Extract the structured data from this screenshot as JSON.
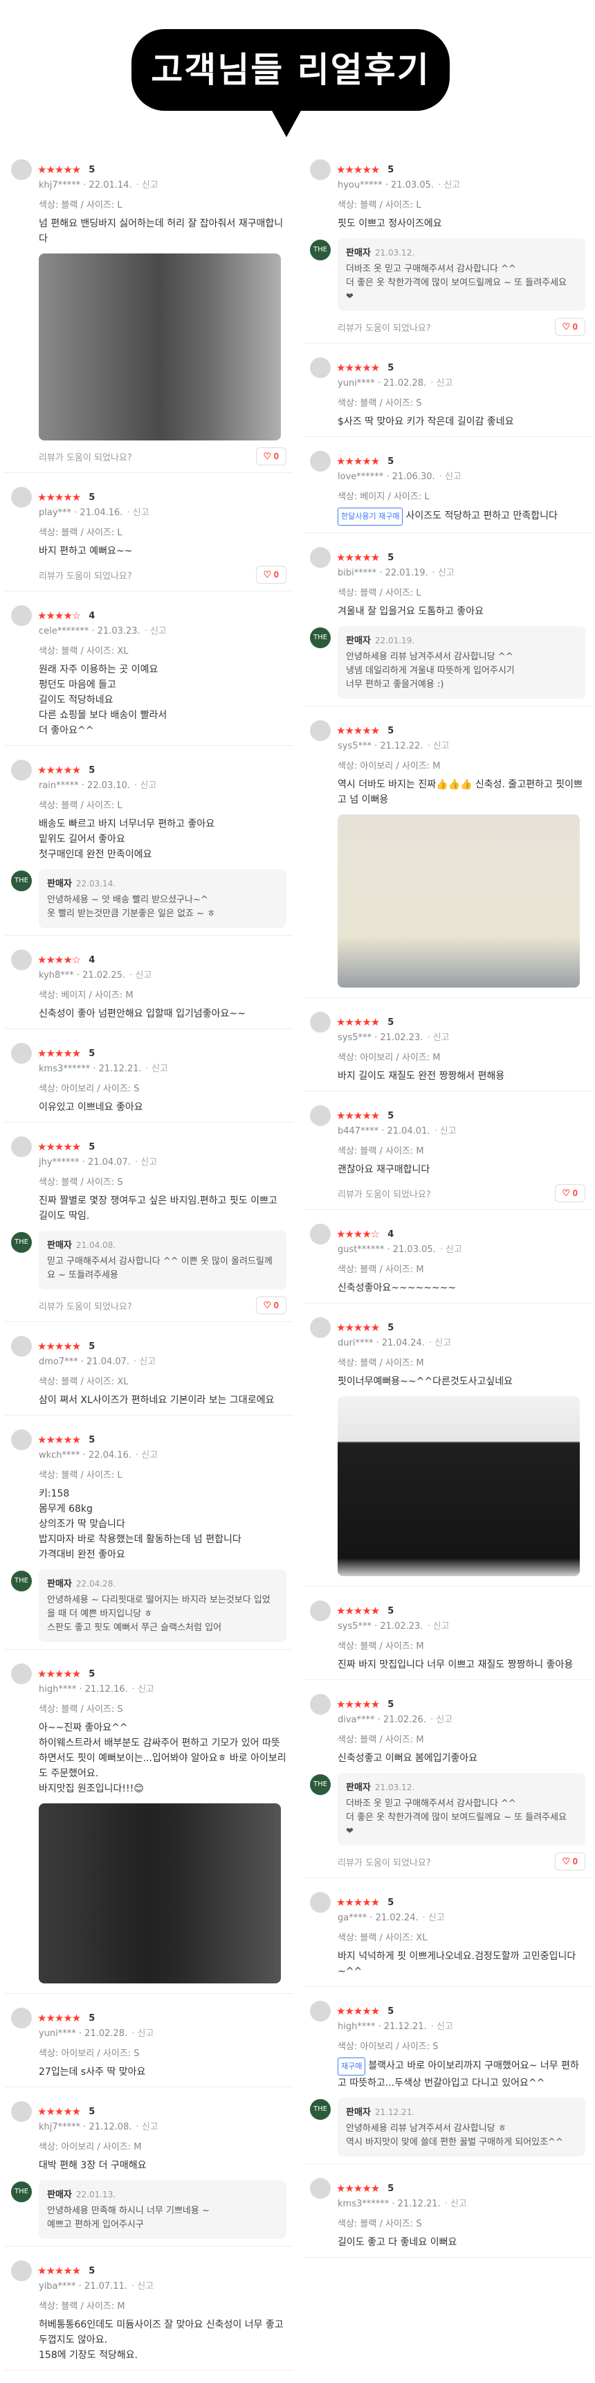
{
  "banner": {
    "title": "고객님들 리얼후기"
  },
  "labels": {
    "report": "신고",
    "helpful": "리뷰가 도움이 되었나요?",
    "seller": "판매자"
  },
  "left": [
    {
      "stars": "★★★★★",
      "score": "5",
      "user": "khj7*****",
      "date": "22.01.14.",
      "opt": "색상: 블랙 / 사이즈: L",
      "body": "넘 편해요 밴딩바지 싫어하는데 허리 잘 잡아줘서 재구매합니다",
      "photo": "pants-dark",
      "likes": "0"
    },
    {
      "stars": "★★★★★",
      "score": "5",
      "user": "play***",
      "date": "21.04.16.",
      "opt": "색상: 블랙 / 사이즈: L",
      "body": "바지 편하고 예뻐요~~",
      "likes": "0"
    },
    {
      "stars": "★★★★☆",
      "score": "4",
      "user": "cele*******",
      "date": "21.03.23.",
      "opt": "색상: 블랙 / 사이즈: XL",
      "body": "원래 자주 이용하는 곳 이예요\n펑던도 마음에 들고\n길이도 적당하네요\n다른 쇼핑몰 보다 배송이 빨라서\n더 좋아요^^"
    },
    {
      "stars": "★★★★★",
      "score": "5",
      "user": "rain*****",
      "date": "22.03.10.",
      "opt": "색상: 블랙 / 사이즈: L",
      "body": "배송도 빠르고 바지 너무너무 편하고 좋아요\n밑위도 길어서 좋아요\n첫구매인데 완전 만족이에요",
      "seller": {
        "date": "22.03.14.",
        "text": "안녕하세용 ~ 앗 배송 빨리 받으셨구나~^\n옷 빨리 받는것만큼 기분좋은 일은 없죠 ~ ㅎ"
      }
    },
    {
      "stars": "★★★★☆",
      "score": "4",
      "user": "kyh8***",
      "date": "21.02.25.",
      "opt": "색상: 베이지 / 사이즈: M",
      "body": "신축성이 좋아 넘편안해요 입할때 입기넘좋아요~~"
    },
    {
      "stars": "★★★★★",
      "score": "5",
      "user": "kms3******",
      "date": "21.12.21.",
      "opt": "색상: 아이보리 / 사이즈: S",
      "body": "이유있고 이쁘네요 좋아요"
    },
    {
      "stars": "★★★★★",
      "score": "5",
      "user": "jhy******",
      "date": "21.04.07.",
      "opt": "색상: 블랙 / 사이즈: S",
      "body": "진짜 짤별로 몇장 쟁여두고 싶은 바지임.편하고 핏도 이쁘고 길이도 딱임.",
      "seller": {
        "date": "21.04.08.",
        "text": "믿고 구매해주셔서 감사합니다 ^^ 이쁜 옷 많이 올려드릴께요 ~ 또들려주세용"
      },
      "likes": "0"
    },
    {
      "stars": "★★★★★",
      "score": "5",
      "user": "dmo7***",
      "date": "21.04.07.",
      "opt": "색상: 블랙 / 사이즈: XL",
      "body": "삼이 쪄서 XL사이즈가 편하네요 기본이라 보는 그대로에요"
    },
    {
      "stars": "★★★★★",
      "score": "5",
      "user": "wkch****",
      "date": "22.04.16.",
      "opt": "색상: 블랙 / 사이즈: L",
      "body": "키:158\n몸무게 68kg\n상의조가 딱 맞습니다\n밥지마자 바로 착용했는데 활동하는데 넘 편합니다\n가격대비 완전 좋아요",
      "seller": {
        "date": "22.04.28.",
        "text": "안녕하세용 ~ 다리핏대로 떨어지는 바지라 보는것보다 입었을 때 더 예쁜 바지입니당 ㅎ\n스판도 좋고 핏도 예뻐서 쭈근 슬랙스처럼 입어"
      }
    },
    {
      "stars": "★★★★★",
      "score": "5",
      "user": "high****",
      "date": "21.12.16.",
      "opt": "색상: 블랙 / 사이즈: S",
      "body": "아~~진짜 좋아요^^\n하이웨스트라서 배부분도 감싸주어 편하고 기모가 있어 따뜻하면서도 핏이 예뻐보이는...입어봐야 알아요ㅎ 바로 아이보리도 주문했어요.\n바지맛집 원조입니다!!!😊",
      "photo": "pants-navy"
    },
    {
      "stars": "★★★★★",
      "score": "5",
      "user": "yuni****",
      "date": "21.02.28.",
      "opt": "색상: 아이보리 / 사이즈: S",
      "body": "27입는데 s사주 딱 맞아요"
    },
    {
      "stars": "★★★★★",
      "score": "5",
      "user": "khj7*****",
      "date": "21.12.08.",
      "opt": "색상: 아이보리 / 사이즈: M",
      "body": "대박 편해 3장 더 구매해요",
      "seller": {
        "date": "22.01.13.",
        "text": "안녕하세용 만족해 하시니 너무 기쁘네용 ~\n예쁘고 편하게 입어주시구"
      }
    },
    {
      "stars": "★★★★★",
      "score": "5",
      "user": "yiba****",
      "date": "21.07.11.",
      "opt": "색상: 블랙 / 사이즈: M",
      "body": "허베통통66인데도 미듐사이즈 잘 맞아요 신축성이 너무 좋고 두껍지도 않아요.\n158에 기장도 적당해요."
    }
  ],
  "right": [
    {
      "stars": "★★★★★",
      "score": "5",
      "user": "hyou*****",
      "date": "21.03.05.",
      "opt": "색상: 블랙 / 사이즈: L",
      "body": "핏도 이쁘고 정사이즈에요",
      "seller": {
        "date": "21.03.12.",
        "text": "더바조 옷 믿고 구매해주셔서 감사합니다 ^^\n더 좋은 옷 착한가격에 많이 보여드릴께요 ~ 또 들려주세요 ❤"
      },
      "likes": "0"
    },
    {
      "stars": "★★★★★",
      "score": "5",
      "user": "yuni****",
      "date": "21.02.28.",
      "opt": "색상: 블랙 / 사이즈: S",
      "body": "$사즈 딱 맞아요 키가 작은데 길이감 좋네요"
    },
    {
      "stars": "★★★★★",
      "score": "5",
      "user": "love******",
      "date": "21.06.30.",
      "opt": "색상: 베이지 / 사이즈: L",
      "tag": "한달사용기 재구매",
      "body": "사이즈도 적당하고 편하고 만족합니다"
    },
    {
      "stars": "★★★★★",
      "score": "5",
      "user": "bibi*****",
      "date": "22.01.19.",
      "opt": "색상: 블랙 / 사이즈: L",
      "body": "겨울내 잘 입을거요 도톰하고 좋아요",
      "seller": {
        "date": "22.01.19.",
        "text": "안녕하세용 리뷰 남겨주셔서 감사합니당 ^^\n냉넴 데일리하게 겨울내 따뜻하게 입어주시기\n너무 편하고 좋을거예용 :)"
      }
    },
    {
      "stars": "★★★★★",
      "score": "5",
      "user": "sys5***",
      "date": "21.12.22.",
      "opt": "색상: 아이보리 / 사이즈: M",
      "body": "역시 더바도 바지는 진짜👍👍👍 신축성. 줄고편하고 핏이쁘고 넘 이뻐용",
      "photo": "pants-cream"
    },
    {
      "stars": "★★★★★",
      "score": "5",
      "user": "sys5***",
      "date": "21.02.23.",
      "opt": "색상: 아이보리 / 사이즈: M",
      "body": "바지 길이도 재질도 완전 짱짱해서 편해용"
    },
    {
      "stars": "★★★★★",
      "score": "5",
      "user": "b447****",
      "date": "21.04.01.",
      "opt": "색상: 블랙 / 사이즈: M",
      "body": "괜찮아요 재구매합니다",
      "likes": "0"
    },
    {
      "stars": "★★★★☆",
      "score": "4",
      "user": "gust******",
      "date": "21.03.05.",
      "opt": "색상: 블랙 / 사이즈: M",
      "body": "신축성좋아요~~~~~~~~"
    },
    {
      "stars": "★★★★★",
      "score": "5",
      "user": "duri****",
      "date": "21.04.24.",
      "opt": "색상: 블랙 / 사이즈: M",
      "body": "핏이너무예뻐용~~^^다른것도사고싶네요",
      "photo": "pants-black"
    },
    {
      "stars": "★★★★★",
      "score": "5",
      "user": "sys5***",
      "date": "21.02.23.",
      "opt": "색상: 블랙 / 사이즈: M",
      "body": "진짜 바지 맛집입니다 너무 이쁘고 재질도 짱짱하니 좋아용"
    },
    {
      "stars": "★★★★★",
      "score": "5",
      "user": "diva****",
      "date": "21.02.26.",
      "opt": "색상: 블랙 / 사이즈: M",
      "body": "신축성좋고 이뻐요 봄에입기좋아요",
      "seller": {
        "date": "21.03.12.",
        "text": "더바조 옷 믿고 구매해주셔서 감사합니다 ^^\n더 좋은 옷 착한가격에 많이 보여드릴께요 ~ 또 들려주세요 ❤"
      },
      "likes": "0"
    },
    {
      "stars": "★★★★★",
      "score": "5",
      "user": "ga****",
      "date": "21.02.24.",
      "opt": "색상: 블랙 / 사이즈: XL",
      "body": "바지 넉넉하게 핏 이쁘게나오네요.검정도할까 고민중입니다~^^"
    },
    {
      "stars": "★★★★★",
      "score": "5",
      "user": "high****",
      "date": "21.12.21.",
      "opt": "색상: 아이보리 / 사이즈: S",
      "tag": "재구매",
      "body": "블랙사고 바로 아이보리까지 구매했어요~ 너무 편하고 따뜻하고...두색상 번갈아입고 다니고 있어요^^",
      "seller": {
        "date": "21.12.21.",
        "text": "안녕하세용 리뷰 남겨주셔서 감사합니당 ㅎ\n역시 바지맛이 맞에 쓸데 편한 꿀벌 구매하게 되어있조^^"
      }
    },
    {
      "stars": "★★★★★",
      "score": "5",
      "user": "kms3******",
      "date": "21.12.21.",
      "opt": "색상: 블랙 / 사이즈: S",
      "body": "길이도 좋고 다 좋네요 이뻐요"
    }
  ]
}
